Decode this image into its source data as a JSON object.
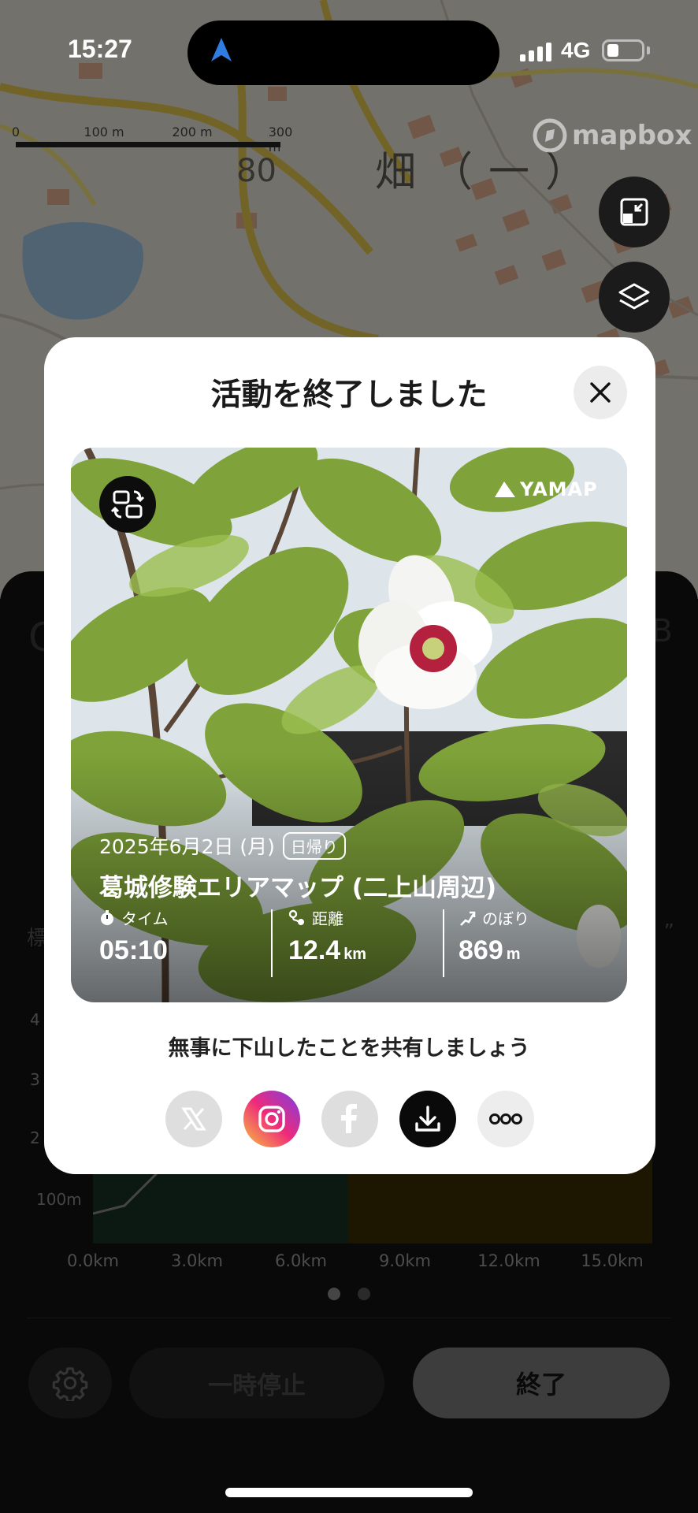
{
  "status_bar": {
    "time": "15:27",
    "network": "4G"
  },
  "map": {
    "scale_ticks": [
      "0",
      "100 m",
      "200 m",
      "300 m"
    ],
    "attribution": "mapbox",
    "place_label": "畑（一）",
    "road_number": "80"
  },
  "background_panel": {
    "elevation_ticks": [
      "4",
      "3",
      "2",
      "100m"
    ],
    "distance_ticks": [
      "0.0km",
      "3.0km",
      "6.0km",
      "9.0km",
      "12.0km",
      "15.0km"
    ],
    "pause_label": "一時停止",
    "end_label": "終了"
  },
  "modal": {
    "title": "活動を終了しました",
    "brand": "YAMAP",
    "date": "2025年6月2日 (月)",
    "trip_type": "日帰り",
    "route": "葛城修験エリアマップ (二上山周辺)",
    "stats": [
      {
        "label": "タイム",
        "value": "05:10",
        "unit": ""
      },
      {
        "label": "距離",
        "value": "12.4",
        "unit": "km"
      },
      {
        "label": "のぼり",
        "value": "869",
        "unit": "m"
      }
    ],
    "share_prompt": "無事に下山したことを共有しましょう",
    "share_buttons": [
      "x-icon",
      "instagram-icon",
      "facebook-icon",
      "download-icon",
      "more-icon"
    ]
  },
  "colors": {
    "accent_blue": "#2f7de1",
    "leaf_green": "#7fa33a",
    "flower_center": "#b3213f"
  }
}
